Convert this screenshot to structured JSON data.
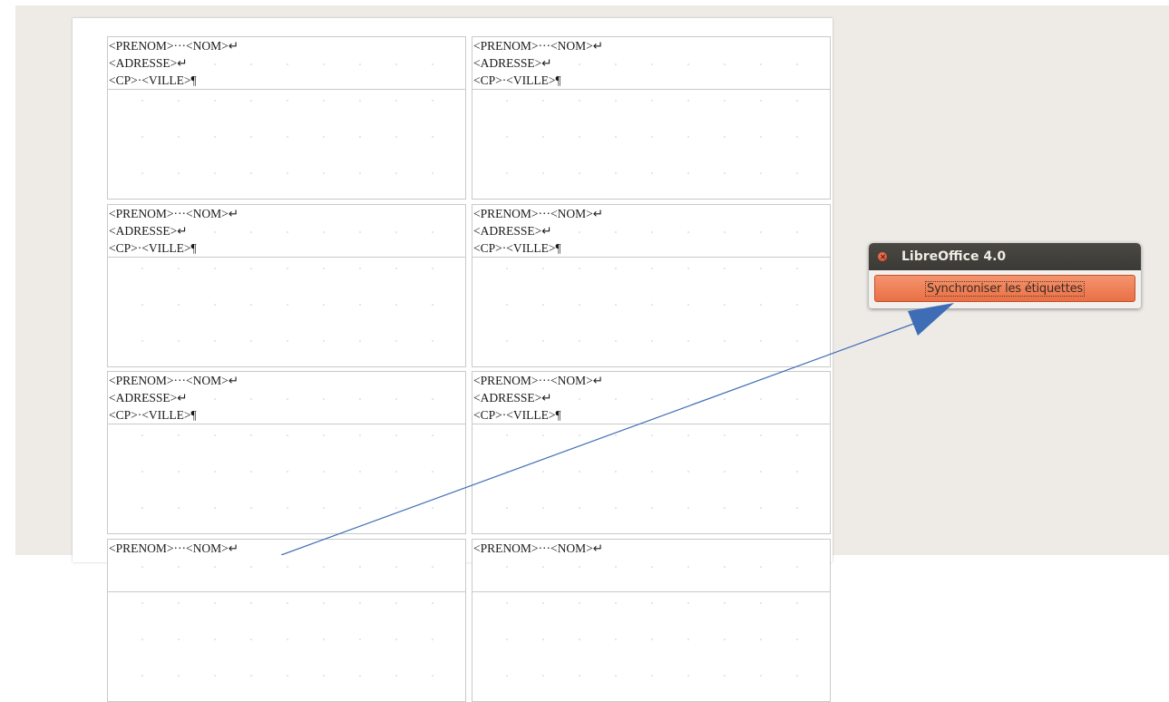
{
  "document": {
    "labels": [
      {
        "line1": "<PRENOM>···<NOM>↵",
        "line2": "<ADRESSE>↵",
        "line3": "<CP>·<VILLE>¶"
      },
      {
        "line1": "<PRENOM>···<NOM>↵",
        "line2": "<ADRESSE>↵",
        "line3": "<CP>·<VILLE>¶"
      },
      {
        "line1": "<PRENOM>···<NOM>↵",
        "line2": "<ADRESSE>↵",
        "line3": "<CP>·<VILLE>¶"
      },
      {
        "line1": "<PRENOM>···<NOM>↵",
        "line2": "<ADRESSE>↵",
        "line3": "<CP>·<VILLE>¶"
      },
      {
        "line1": "<PRENOM>···<NOM>↵",
        "line2": "<ADRESSE>↵",
        "line3": "<CP>·<VILLE>¶"
      },
      {
        "line1": "<PRENOM>···<NOM>↵",
        "line2": "<ADRESSE>↵",
        "line3": "<CP>·<VILLE>¶"
      },
      {
        "line1": "<PRENOM>···<NOM>↵",
        "line2": "",
        "line3": ""
      },
      {
        "line1": "<PRENOM>···<NOM>↵",
        "line2": "",
        "line3": ""
      }
    ]
  },
  "dialog": {
    "title": "LibreOffice 4.0",
    "button_label": "Synchroniser les étiquettes"
  },
  "colors": {
    "workspace_bg": "#eeebe7",
    "titlebar": "#3c3b37",
    "button_accent": "#ef7d55",
    "close_button": "#e2532d",
    "arrow": "#3f6db5"
  },
  "icons": {
    "close": "close-icon",
    "arrow": "annotation-arrow"
  }
}
